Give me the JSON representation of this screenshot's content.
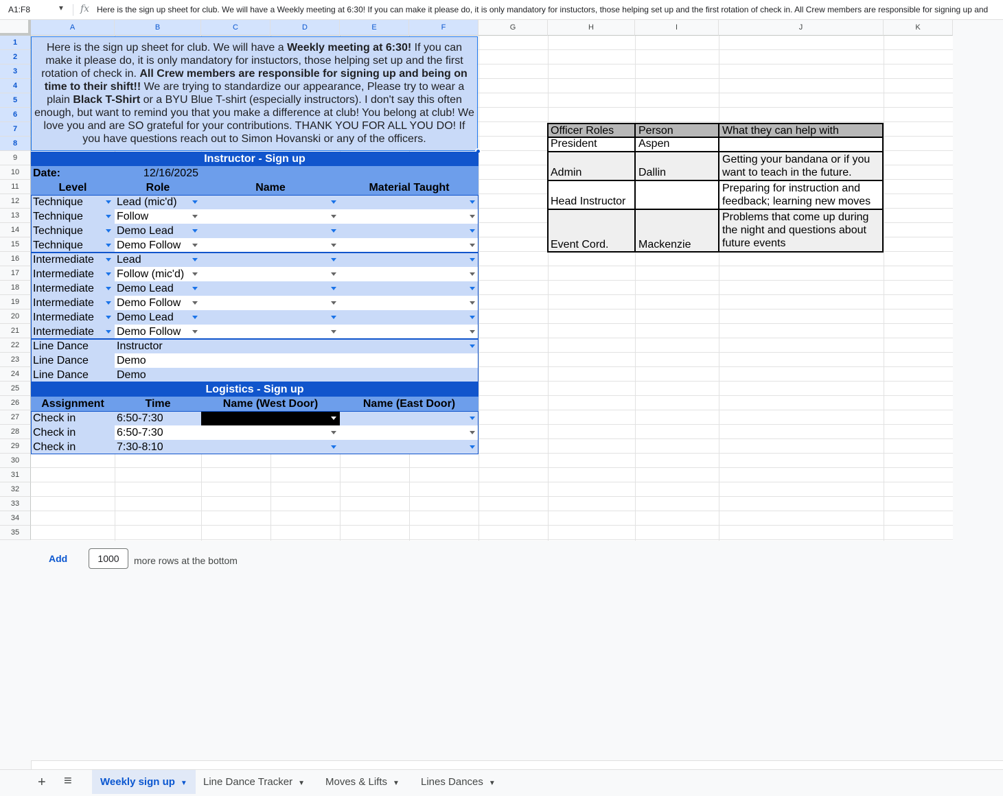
{
  "formula_bar": {
    "cell_ref": "A1:F8",
    "fx": "fx",
    "content": "Here is the sign up sheet for club. We will have a Weekly meeting at 6:30! If you can make it please do, it is only mandatory for instuctors, those helping set up and the first rotation of check in. All Crew members are responsible for signing up and"
  },
  "columns": [
    "A",
    "B",
    "C",
    "D",
    "E",
    "F",
    "G",
    "H",
    "I",
    "J",
    "K"
  ],
  "rows": [
    "1",
    "2",
    "3",
    "4",
    "5",
    "6",
    "7",
    "8",
    "9",
    "10",
    "11",
    "12",
    "13",
    "14",
    "15",
    "16",
    "17",
    "18",
    "19",
    "20",
    "21",
    "22",
    "23",
    "24",
    "25",
    "26",
    "27",
    "28",
    "29",
    "30",
    "31",
    "32",
    "33",
    "34",
    "35"
  ],
  "intro": {
    "p1": "Here is the sign up sheet for club. We will have a ",
    "b1": "Weekly meeting at 6:30!",
    "p2": " If you can make it please do, it is only mandatory for instuctors, those helping set up and the first rotation of check in. ",
    "b2": "All Crew members are responsible for signing up and being on time to their shift!!",
    "p3": "  We are trying to standardize our appearance, Please try to wear a plain ",
    "b3": "Black T-Shirt",
    "p4": " or a BYU Blue T-shirt (especially instructors). I don't say this often enough, but want to remind you that you make a difference at club! You belong at club! We love you and are SO grateful for your contributions. THANK YOU FOR ALL YOU DO! If you have questions reach out to Simon Hovanski or any of the officers."
  },
  "instructor": {
    "title": "Instructor - Sign up",
    "date_label": "Date:",
    "date_value": "12/16/2025",
    "headers": [
      "Level",
      "Role",
      "Name",
      "Material Taught"
    ],
    "rows": [
      {
        "level": "Technique",
        "role": "Lead (mic'd)"
      },
      {
        "level": "Technique",
        "role": "Follow"
      },
      {
        "level": "Technique",
        "role": "Demo Lead"
      },
      {
        "level": "Technique",
        "role": "Demo Follow"
      },
      {
        "level": "Intermediate",
        "role": "Lead"
      },
      {
        "level": "Intermediate",
        "role": "Follow (mic'd)"
      },
      {
        "level": "Intermediate",
        "role": "Demo Lead"
      },
      {
        "level": "Intermediate",
        "role": "Demo Follow"
      },
      {
        "level": "Intermediate",
        "role": "Demo Lead"
      },
      {
        "level": "Intermediate",
        "role": "Demo Follow"
      },
      {
        "level": "Line Dance",
        "role": "Instructor"
      },
      {
        "level": "Line Dance",
        "role": "Demo"
      },
      {
        "level": "Line Dance",
        "role": "Demo"
      }
    ]
  },
  "logistics": {
    "title": "Logistics - Sign up",
    "headers": [
      "Assignment",
      "Time",
      "Name (West Door)",
      "Name (East Door)"
    ],
    "rows": [
      {
        "assignment": "Check in",
        "time": "6:50-7:30"
      },
      {
        "assignment": "Check in",
        "time": "6:50-7:30"
      },
      {
        "assignment": "Check in",
        "time": "7:30-8:10"
      }
    ]
  },
  "officers": {
    "headers": [
      "Officer Roles",
      "Person",
      "What they can help with"
    ],
    "rows": [
      {
        "role": "President",
        "person": "Aspen",
        "help": ""
      },
      {
        "role": "Admin",
        "person": "Dallin",
        "help": "Getting your bandana or if you want to teach in the future."
      },
      {
        "role": "Head Instructor",
        "person": "",
        "help": "Preparing for instruction and feedback; learning new moves"
      },
      {
        "role": "Event Cord.",
        "person": "Mackenzie",
        "help": "Problems that come up during the night and questions about future events"
      }
    ]
  },
  "add_rows": {
    "link": "Add",
    "count": "1000",
    "suffix": "more rows at the bottom"
  },
  "tabs": [
    {
      "label": "Weekly sign up",
      "active": true
    },
    {
      "label": "Line Dance Tracker",
      "active": false
    },
    {
      "label": "Moves & Lifts",
      "active": false
    },
    {
      "label": "Lines Dances",
      "active": false
    }
  ],
  "icons": {
    "add_sheet": "plus-icon",
    "all_sheets": "menu-icon",
    "dropdown": "caret-down-icon"
  },
  "colors": {
    "light_blue": "#c9daf8",
    "mid_blue": "#6d9eeb",
    "dark_blue": "#1155cc",
    "officer_header": "#b7b7b7",
    "selection": "#1a73e8"
  }
}
